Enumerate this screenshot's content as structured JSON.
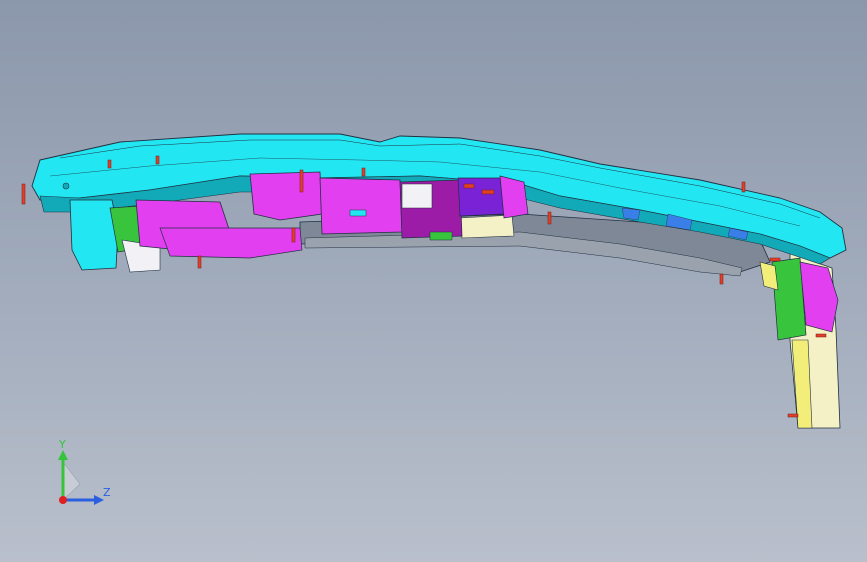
{
  "viewport": {
    "background_top": "#8b97ab",
    "background_bottom": "#b9c0cc"
  },
  "model": {
    "colors": {
      "cyan": "#22e6f2",
      "cyan_dark": "#12aab8",
      "magenta": "#e23ff0",
      "magenta_dark": "#9c1ca8",
      "purple": "#7a22d6",
      "gray": "#7f8896",
      "gray_light": "#9aa2ae",
      "cream": "#f4f1c6",
      "yellow": "#f3ee7a",
      "green": "#39c43d",
      "blue": "#3a7ee8",
      "red": "#e0402a",
      "white": "#f2f2f6",
      "edge": "#203040"
    }
  },
  "triad": {
    "y_label": "Y",
    "z_label": "Z",
    "y_color": "#35c43a",
    "z_color": "#2a5fe0",
    "x_color": "#e02020",
    "origin_color": "#c8ccd4"
  }
}
